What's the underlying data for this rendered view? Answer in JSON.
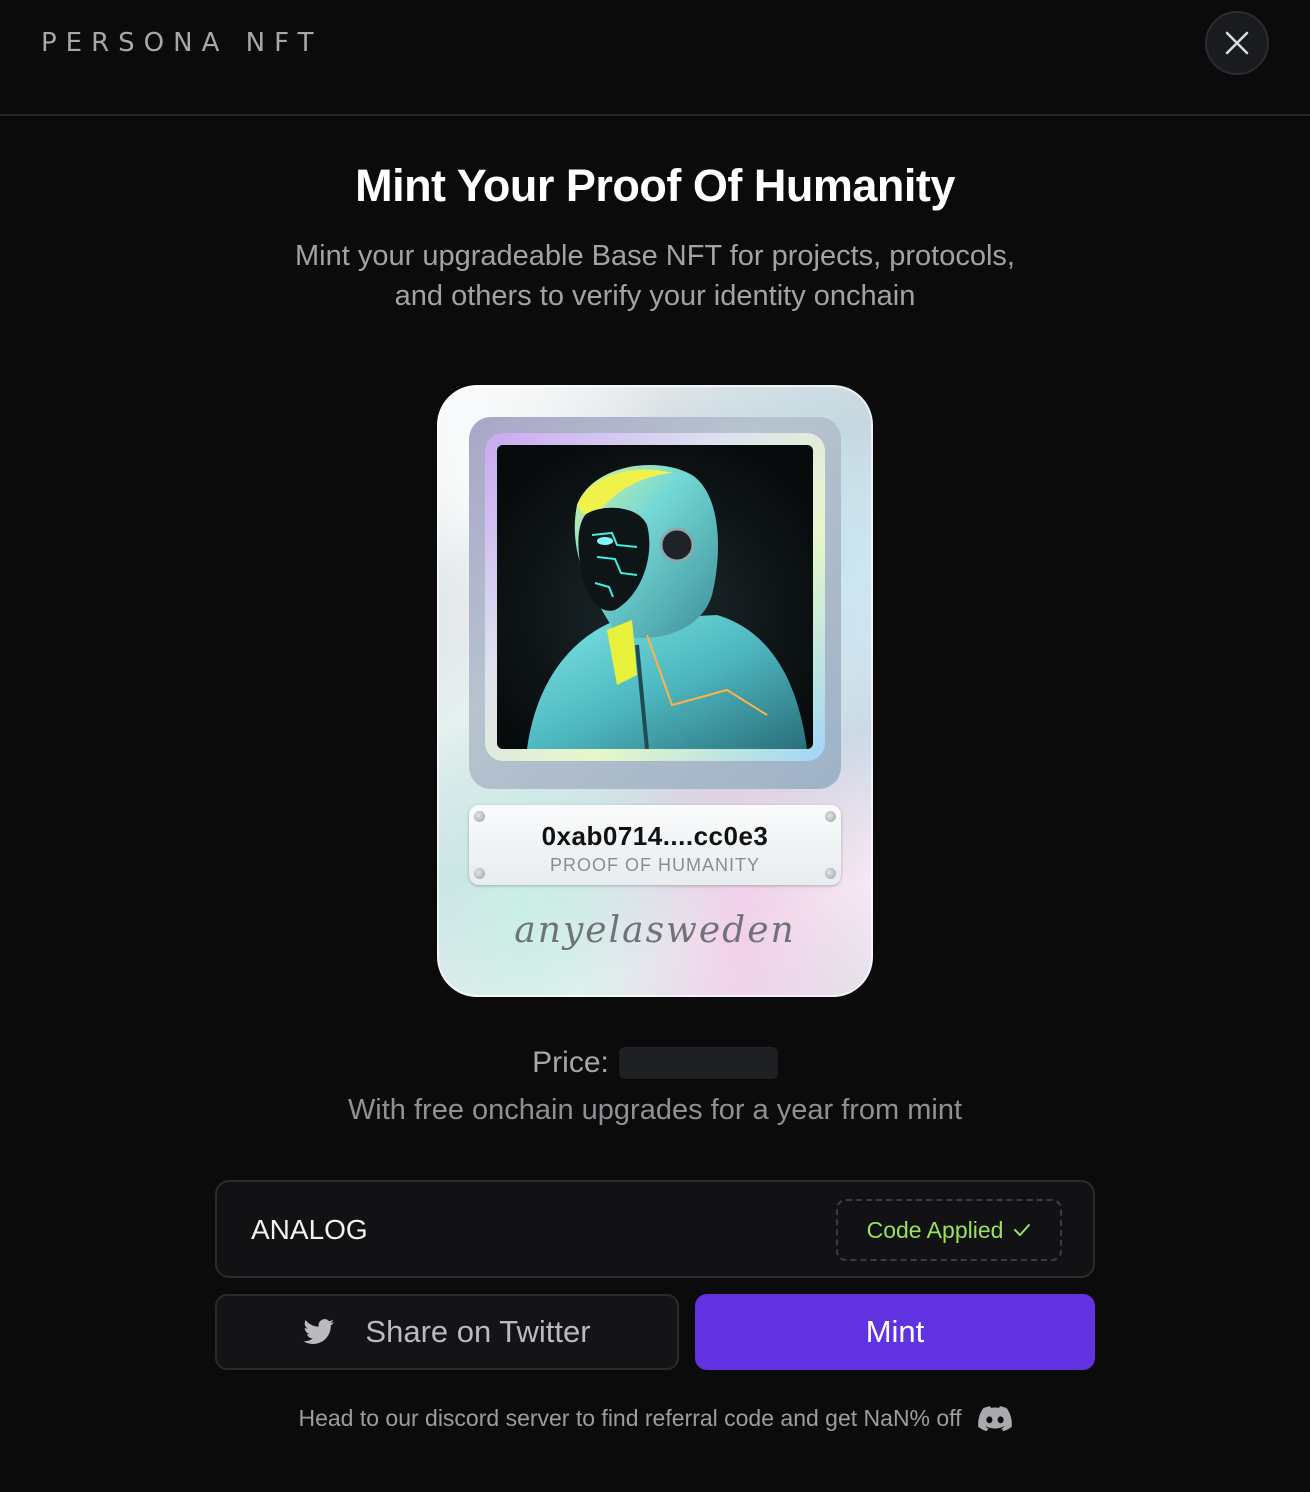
{
  "header": {
    "brand": "PERSONA NFT",
    "close_icon": "close-icon"
  },
  "hero": {
    "title": "Mint Your Proof Of Humanity",
    "subtitle_line1": "Mint your upgradeable Base NFT for projects, protocols,",
    "subtitle_line2": "and others to verify your identity onchain"
  },
  "card": {
    "address": "0xab0714....cc0e3",
    "caption": "PROOF OF HUMANITY",
    "signature": "anyelasweden",
    "image_icon": "hooded-cyber-figure-portrait"
  },
  "pricing": {
    "price_label": "Price:",
    "upgrade_note": "With free onchain upgrades for a year from mint"
  },
  "referral": {
    "code_value": "ANALOG",
    "status_label": "Code Applied",
    "status_icon": "check-icon"
  },
  "actions": {
    "twitter_label": "Share on Twitter",
    "twitter_icon": "twitter-bird-icon",
    "mint_label": "Mint"
  },
  "footer": {
    "note": "Head to our discord server to find referral code and get NaN% off",
    "discord_icon": "discord-icon"
  },
  "colors": {
    "background": "#0b0b0c",
    "accent": "#6133e0",
    "success": "#9be15d"
  }
}
